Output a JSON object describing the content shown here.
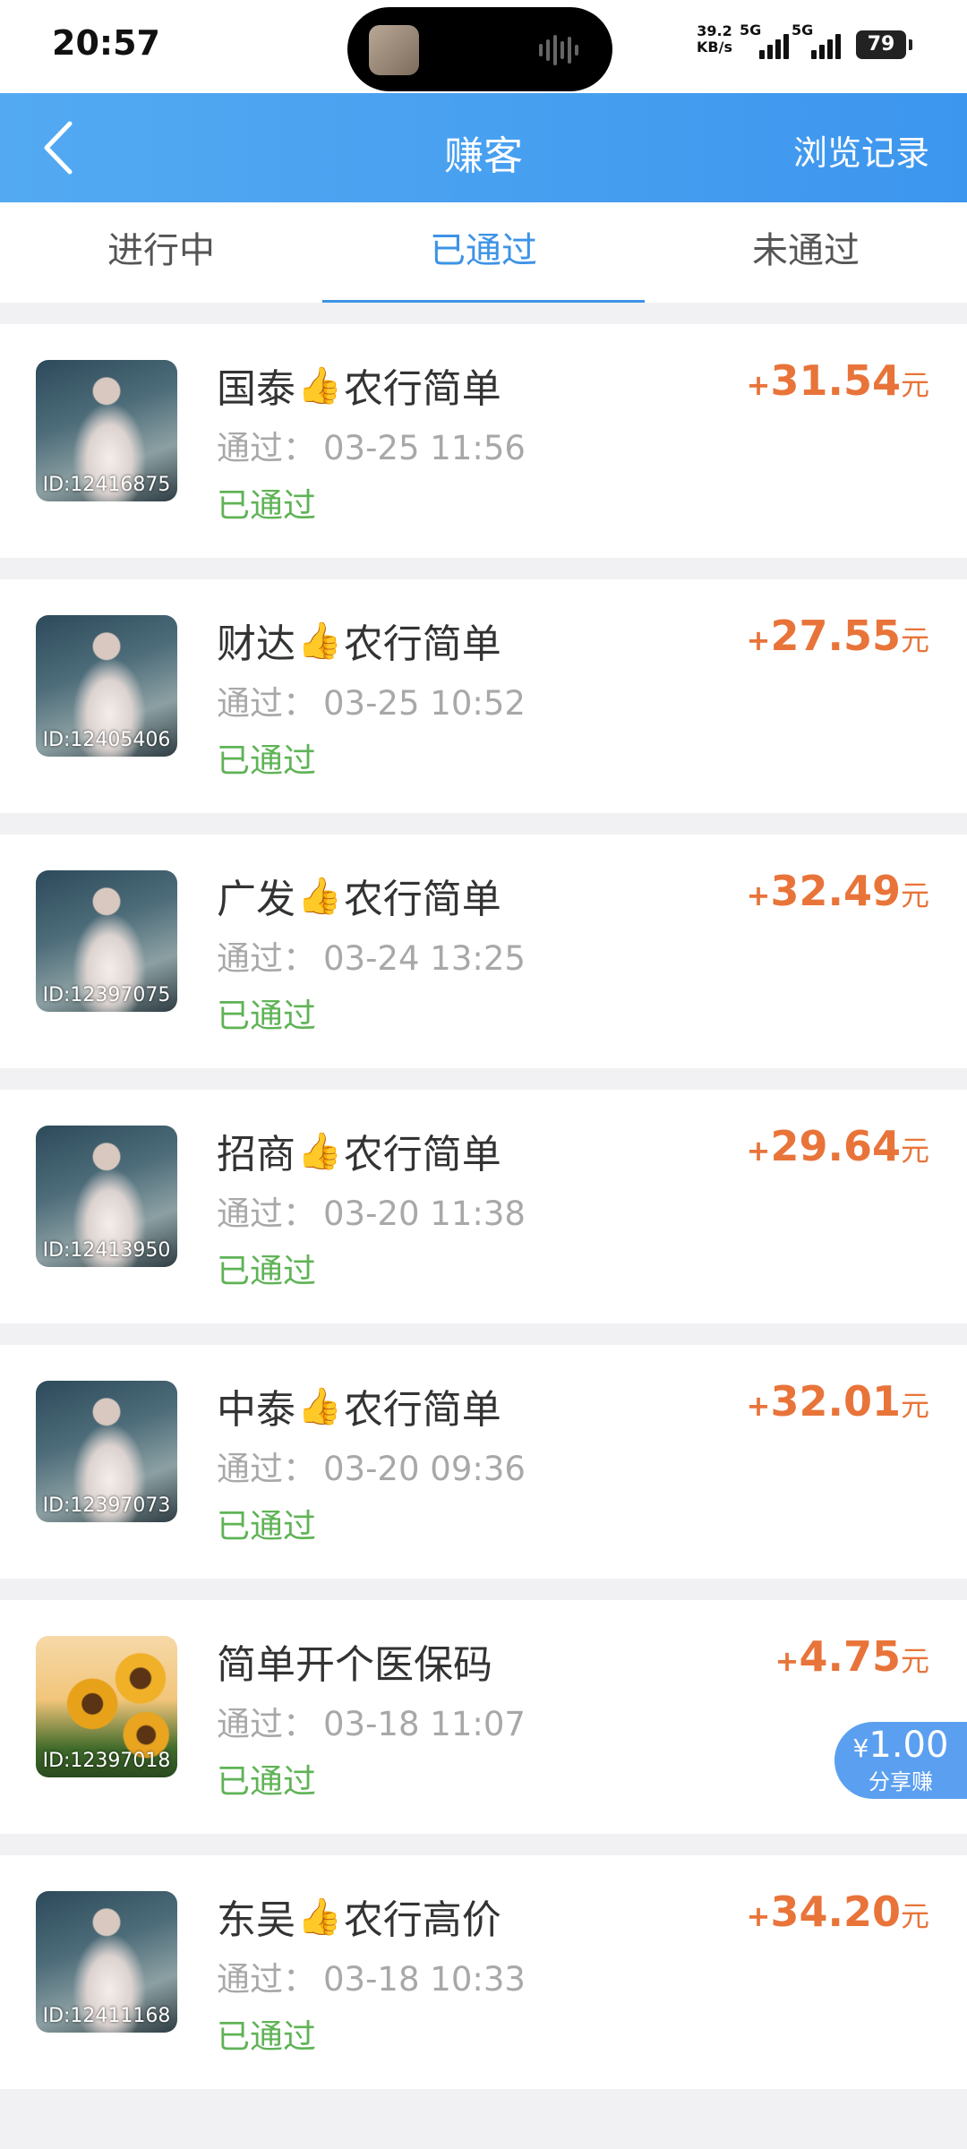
{
  "status_bar": {
    "time": "20:57",
    "net_speed_value": "39.2",
    "net_speed_unit": "KB/s",
    "signal1_label": "5G",
    "signal2_label": "5G",
    "battery": "79"
  },
  "header": {
    "title": "赚客",
    "history_label": "浏览记录"
  },
  "tabs": [
    {
      "label": "进行中"
    },
    {
      "label": "已通过"
    },
    {
      "label": "未通过"
    }
  ],
  "active_tab": "已通过",
  "items": [
    {
      "id": "ID:12416875",
      "name_pre": "国泰",
      "emoji": "👍",
      "name_post": "农行简单",
      "time_label": "通过",
      "time_sep": "：",
      "time": "03-25 11:56",
      "status": "已通过",
      "reward_sign": "+",
      "reward": "31.54",
      "unit": "元",
      "thumb": "bride"
    },
    {
      "id": "ID:12405406",
      "name_pre": "财达",
      "emoji": "👍",
      "name_post": "农行简单",
      "time_label": "通过",
      "time_sep": "：",
      "time": "03-25 10:52",
      "status": "已通过",
      "reward_sign": "+",
      "reward": "27.55",
      "unit": "元",
      "thumb": "bride"
    },
    {
      "id": "ID:12397075",
      "name_pre": "广发",
      "emoji": "👍",
      "name_post": "农行简单",
      "time_label": "通过",
      "time_sep": "：",
      "time": "03-24 13:25",
      "status": "已通过",
      "reward_sign": "+",
      "reward": "32.49",
      "unit": "元",
      "thumb": "bride"
    },
    {
      "id": "ID:12413950",
      "name_pre": "招商",
      "emoji": "👍",
      "name_post": "农行简单",
      "time_label": "通过",
      "time_sep": "：",
      "time": "03-20 11:38",
      "status": "已通过",
      "reward_sign": "+",
      "reward": "29.64",
      "unit": "元",
      "thumb": "bride"
    },
    {
      "id": "ID:12397073",
      "name_pre": "中泰",
      "emoji": "👍",
      "name_post": "农行简单",
      "time_label": "通过",
      "time_sep": "：",
      "time": "03-20 09:36",
      "status": "已通过",
      "reward_sign": "+",
      "reward": "32.01",
      "unit": "元",
      "thumb": "bride"
    },
    {
      "id": "ID:12397018",
      "name_pre": "简单开个医保码",
      "emoji": "",
      "name_post": "",
      "time_label": "通过",
      "time_sep": "：",
      "time": "03-18 11:07",
      "status": "已通过",
      "reward_sign": "+",
      "reward": "4.75",
      "unit": "元",
      "thumb": "flower",
      "share": {
        "currency": "¥",
        "amount": "1.00",
        "label": "分享赚"
      }
    },
    {
      "id": "ID:12411168",
      "name_pre": "东吴",
      "emoji": "👍",
      "name_post": "农行高价",
      "time_label": "通过",
      "time_sep": "：",
      "time": "03-18 10:33",
      "status": "已通过",
      "reward_sign": "+",
      "reward": "34.20",
      "unit": "元",
      "thumb": "bride"
    }
  ],
  "colors": {
    "header_gradient_start": "#53aaf2",
    "header_gradient_end": "#3d96ee",
    "active_tab": "#3d93e6",
    "reward": "#e8743a",
    "status_passed": "#5fb356",
    "share_badge": "#5b9ff0"
  },
  "icons": {
    "back": "chevron-left-icon",
    "thumbs_up": "thumbs-up-icon"
  }
}
